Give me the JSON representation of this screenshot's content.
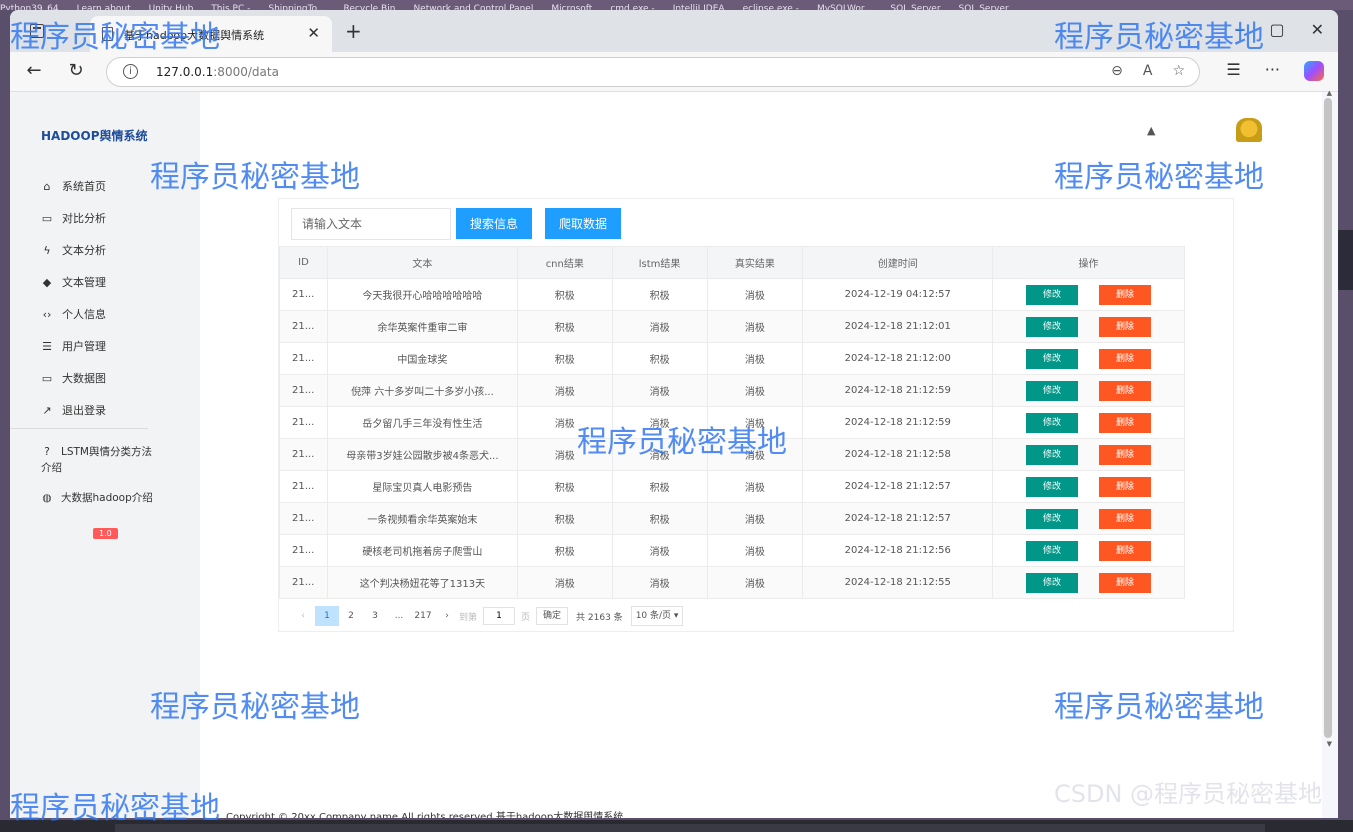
{
  "desktop": {
    "taskbar_labels": [
      "Python39_64",
      "Learn about",
      "Unity Hub",
      "This PC -",
      "ShippingTo...",
      "Recycle Bin",
      "Network and Control Panel",
      "Microsoft",
      "cmd.exe -",
      "IntelliJ IDEA",
      "eclipse.exe -",
      "MySQLWor...",
      "SQL Server",
      "SQL Server"
    ]
  },
  "browser": {
    "tab_title": "基于hadoop大数据舆情系统",
    "url_host": "127.0.0.1",
    "url_rest": ":8000/data"
  },
  "sidebar": {
    "logo": "HADOOP舆情系统",
    "items": [
      {
        "icon": "home-icon",
        "label": "系统首页"
      },
      {
        "icon": "compare-icon",
        "label": "对比分析"
      },
      {
        "icon": "bolt-icon",
        "label": "文本分析"
      },
      {
        "icon": "layers-icon",
        "label": "文本管理"
      },
      {
        "icon": "code-icon",
        "label": "个人信息"
      },
      {
        "icon": "list-icon",
        "label": "用户管理"
      },
      {
        "icon": "chart-icon",
        "label": "大数据图"
      },
      {
        "icon": "trend-icon",
        "label": "退出登录"
      }
    ],
    "extra": [
      {
        "icon": "help-icon",
        "label": "LSTM舆情分类方法介绍"
      },
      {
        "icon": "globe-icon",
        "label": "大数据hadoop介绍"
      }
    ],
    "badge": "1.0"
  },
  "search": {
    "placeholder": "请输入文本",
    "search_button": "搜索信息",
    "crawl_button": "爬取数据"
  },
  "table": {
    "headers": [
      "ID",
      "文本",
      "cnn结果",
      "lstm结果",
      "真实结果",
      "创建时间",
      "操作"
    ],
    "edit_label": "修改",
    "delete_label": "删除",
    "rows": [
      {
        "id": "21...",
        "text": "今天我很开心哈哈哈哈哈哈",
        "cnn": "积极",
        "lstm": "积极",
        "real": "消极",
        "time": "2024-12-19 04:12:57"
      },
      {
        "id": "21...",
        "text": "余华英案件重审二审",
        "cnn": "积极",
        "lstm": "消极",
        "real": "消极",
        "time": "2024-12-18 21:12:01"
      },
      {
        "id": "21...",
        "text": "中国金球奖",
        "cnn": "积极",
        "lstm": "积极",
        "real": "消极",
        "time": "2024-12-18 21:12:00"
      },
      {
        "id": "21...",
        "text": "倪萍 六十多岁叫二十多岁小孩...",
        "cnn": "消极",
        "lstm": "消极",
        "real": "消极",
        "time": "2024-12-18 21:12:59"
      },
      {
        "id": "21...",
        "text": "岳夕留几手三年没有性生活",
        "cnn": "消极",
        "lstm": "消极",
        "real": "消极",
        "time": "2024-12-18 21:12:59"
      },
      {
        "id": "21...",
        "text": "母亲带3岁娃公园散步被4条恶犬...",
        "cnn": "消极",
        "lstm": "消极",
        "real": "消极",
        "time": "2024-12-18 21:12:58"
      },
      {
        "id": "21...",
        "text": "星际宝贝真人电影预告",
        "cnn": "积极",
        "lstm": "积极",
        "real": "消极",
        "time": "2024-12-18 21:12:57"
      },
      {
        "id": "21...",
        "text": "一条视频看余华英案始末",
        "cnn": "积极",
        "lstm": "积极",
        "real": "消极",
        "time": "2024-12-18 21:12:57"
      },
      {
        "id": "21...",
        "text": "硬核老司机拖着房子爬雪山",
        "cnn": "积极",
        "lstm": "消极",
        "real": "消极",
        "time": "2024-12-18 21:12:56"
      },
      {
        "id": "21...",
        "text": "这个判决杨妞花等了1313天",
        "cnn": "消极",
        "lstm": "消极",
        "real": "消极",
        "time": "2024-12-18 21:12:55"
      }
    ]
  },
  "pager": {
    "prev": "‹",
    "pages": [
      "1",
      "2",
      "3",
      "...",
      "217"
    ],
    "next": "›",
    "goto_label": "到第",
    "goto_value": "1",
    "page_unit": "页",
    "confirm": "确定",
    "total": "共 2163 条",
    "per_page": "10 条/页"
  },
  "footer": "Copyright © 20xx.Company name All rights reserved.基于hadoop大数据舆情系统",
  "watermark": "程序员秘密基地",
  "corner_credit": "CSDN @程序员秘密基地"
}
